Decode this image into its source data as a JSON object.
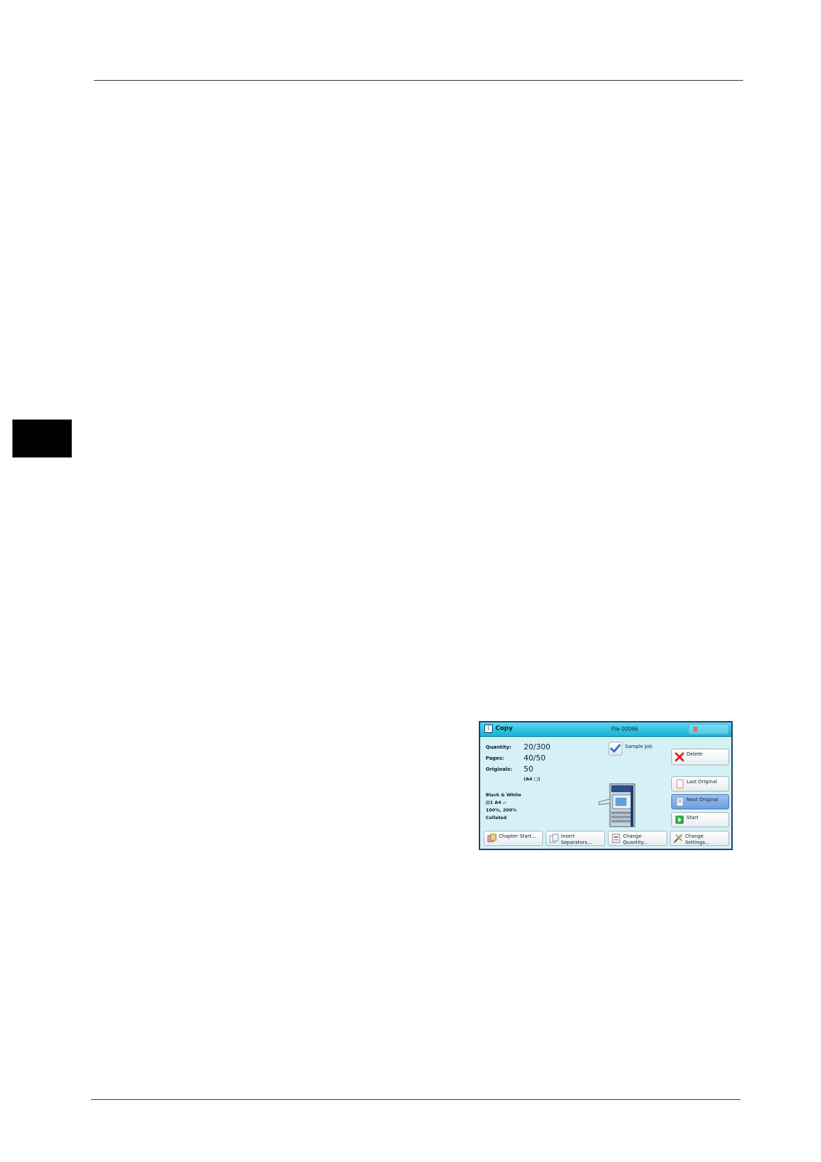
{
  "panel": {
    "title": "Copy",
    "file": "File 00096",
    "quantity_label": "Quantity:",
    "quantity_value": "20/300",
    "pages_label": "Pages:",
    "pages_value": "40/50",
    "originals_label": "Originals:",
    "originals_value": "50",
    "originals_size": "(A4 □)",
    "color_mode": "Black & White",
    "tray_line": "▤1    A4 ▱",
    "reduce_enlarge": "100%, 200%",
    "output": "Collated",
    "sample_job_label": "Sample Job",
    "buttons": {
      "delete": "Delete",
      "last_original": "Last Original",
      "next_original": "Next Original",
      "start": "Start",
      "chapter_start": "Chapter Start...",
      "insert_separators": "Insert\nSeparators...",
      "change_quantity": "Change\nQuantity...",
      "change_settings": "Change\nSettings..."
    }
  }
}
